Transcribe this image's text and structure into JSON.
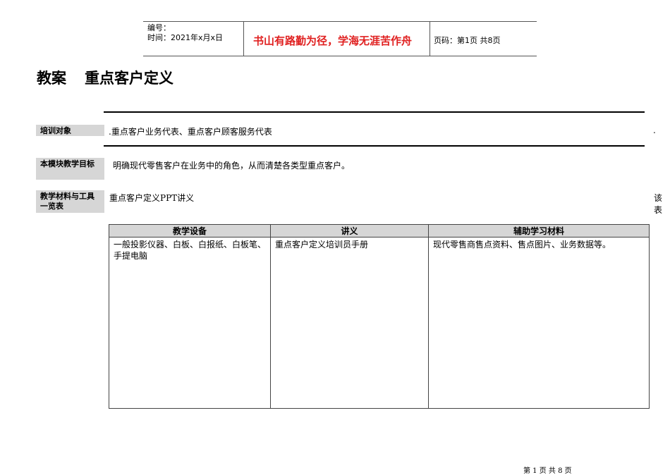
{
  "header": {
    "number_label": "编号：",
    "time_label": "时间：2021年x月x日",
    "motto": "书山有路勤为径，学海无涯苦作舟",
    "page_info": "页码：第1页  共8页"
  },
  "title": {
    "prefix": "教案",
    "name": "重点客户定义"
  },
  "rows": [
    {
      "label": "培训对象",
      "text": ".重点客户业务代表、重点客户顾客服务代表",
      "trail": "."
    },
    {
      "label": "本模块教学目标",
      "text": "明确现代零售客户在业务中的角色，从而清楚各类型重点客户。"
    },
    {
      "label": "教学材料与工具一览表",
      "text": "重点客户定义PPT讲义",
      "trail": "该表"
    }
  ],
  "table": {
    "headers": [
      "教学设备",
      "讲义",
      "辅助学习材料"
    ],
    "cells": [
      "一般投影仪器、白板、白报纸、白板笔、手提电脑",
      "重点客户定义培训员手册",
      "现代零售商售点资料、售点图片、业务数据等。"
    ]
  },
  "footer": "第 1 页  共 8 页"
}
